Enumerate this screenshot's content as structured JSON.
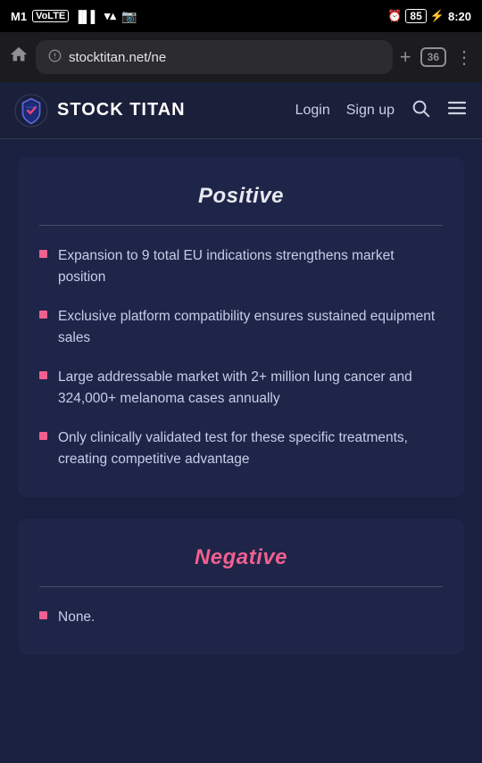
{
  "statusBar": {
    "carrier": "M1",
    "carrierType": "VoLTE",
    "time": "8:20",
    "battery": "85",
    "alarm": true
  },
  "browser": {
    "url": "stocktitan.net/ne",
    "tabCount": "36",
    "homeIcon": "⌂",
    "addIcon": "+",
    "menuIcon": "⋮"
  },
  "siteHeader": {
    "logoText": "STOCK TITAN",
    "loginLabel": "Login",
    "signupLabel": "Sign up",
    "searchIcon": "🔍",
    "menuIcon": "☰"
  },
  "positiveSection": {
    "title": "Positive",
    "bullets": [
      "Expansion to 9 total EU indications strengthens market position",
      "Exclusive platform compatibility ensures sustained equipment sales",
      "Large addressable market with 2+ million lung cancer and 324,000+ melanoma cases annually",
      "Only clinically validated test for these specific treatments, creating competitive advantage"
    ]
  },
  "negativeSection": {
    "title": "Negative",
    "bullets": [
      "None."
    ]
  }
}
